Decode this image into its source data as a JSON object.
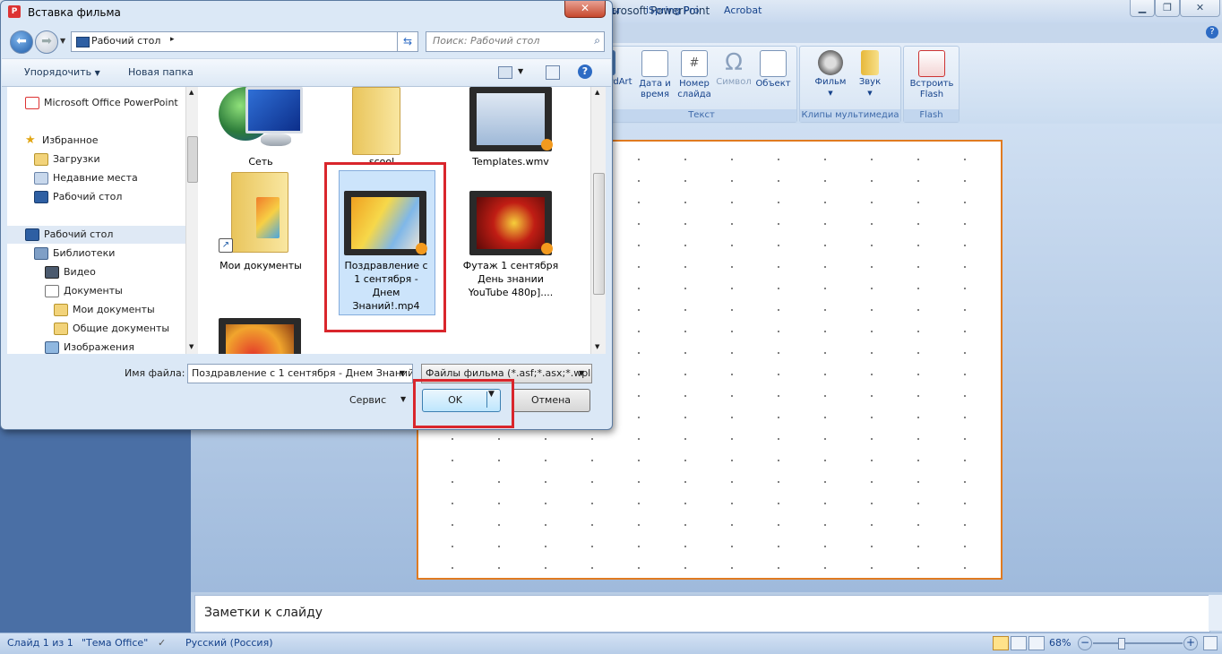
{
  "powerpoint": {
    "title": "icrosoft PowerPoint",
    "tabs": [
      "ы",
      "iSpring Pro",
      "Acrobat"
    ],
    "ribbon": {
      "text_group": {
        "label": "Текст",
        "items": [
          "rdArt",
          "Дата и время",
          "Номер слайда",
          "Символ",
          "Объект"
        ]
      },
      "media_group": {
        "label": "Клипы мультимедиа",
        "items": [
          "Фильм",
          "Звук"
        ]
      },
      "flash_group": {
        "label": "Flash",
        "items": [
          "Встроить Flash"
        ]
      }
    },
    "notes_placeholder": "Заметки к слайду",
    "status": {
      "slide": "Слайд 1 из 1",
      "theme": "\"Тема Office\"",
      "language": "Русский (Россия)",
      "zoom": "68%"
    }
  },
  "dialog": {
    "title": "Вставка фильма",
    "address": "Рабочий стол",
    "search_placeholder": "Поиск: Рабочий стол",
    "toolbar": {
      "organize": "Упорядочить",
      "new_folder": "Новая папка"
    },
    "nav": [
      {
        "label": "Microsoft Office PowerPoint",
        "icon": "powerpoint-icon",
        "indent": 0
      },
      {
        "label": "Избранное",
        "icon": "star-icon",
        "indent": 0
      },
      {
        "label": "Загрузки",
        "icon": "downloads-icon",
        "indent": 1
      },
      {
        "label": "Недавние места",
        "icon": "recent-places-icon",
        "indent": 1
      },
      {
        "label": "Рабочий стол",
        "icon": "desktop-icon",
        "indent": 1
      },
      {
        "label": "Рабочий стол",
        "icon": "desktop-icon",
        "indent": 0
      },
      {
        "label": "Библиотеки",
        "icon": "libraries-icon",
        "indent": 1
      },
      {
        "label": "Видео",
        "icon": "video-icon",
        "indent": 2
      },
      {
        "label": "Документы",
        "icon": "documents-icon",
        "indent": 2
      },
      {
        "label": "Мои документы",
        "icon": "folder-icon",
        "indent": 3
      },
      {
        "label": "Общие документы",
        "icon": "folder-icon",
        "indent": 3
      },
      {
        "label": "Изображения",
        "icon": "pictures-icon",
        "indent": 2
      }
    ],
    "files": {
      "network": "Сеть",
      "scool": "scool",
      "templates": "Templates.wmv",
      "my_documents": "Мои документы",
      "selected_video": "Поздравление с 1 сентября - Днем Знаний!.mp4",
      "footage": "Футаж 1 сентября День знании YouTube 480p]...."
    },
    "file_name_label": "Имя файла:",
    "file_name_value": "Поздравление с 1 сентября - Днем Знаний!.mp4",
    "file_type": "Файлы фильма (*.asf;*.asx;*.wpl",
    "service": "Сервис",
    "ok": "OK",
    "cancel": "Отмена"
  }
}
